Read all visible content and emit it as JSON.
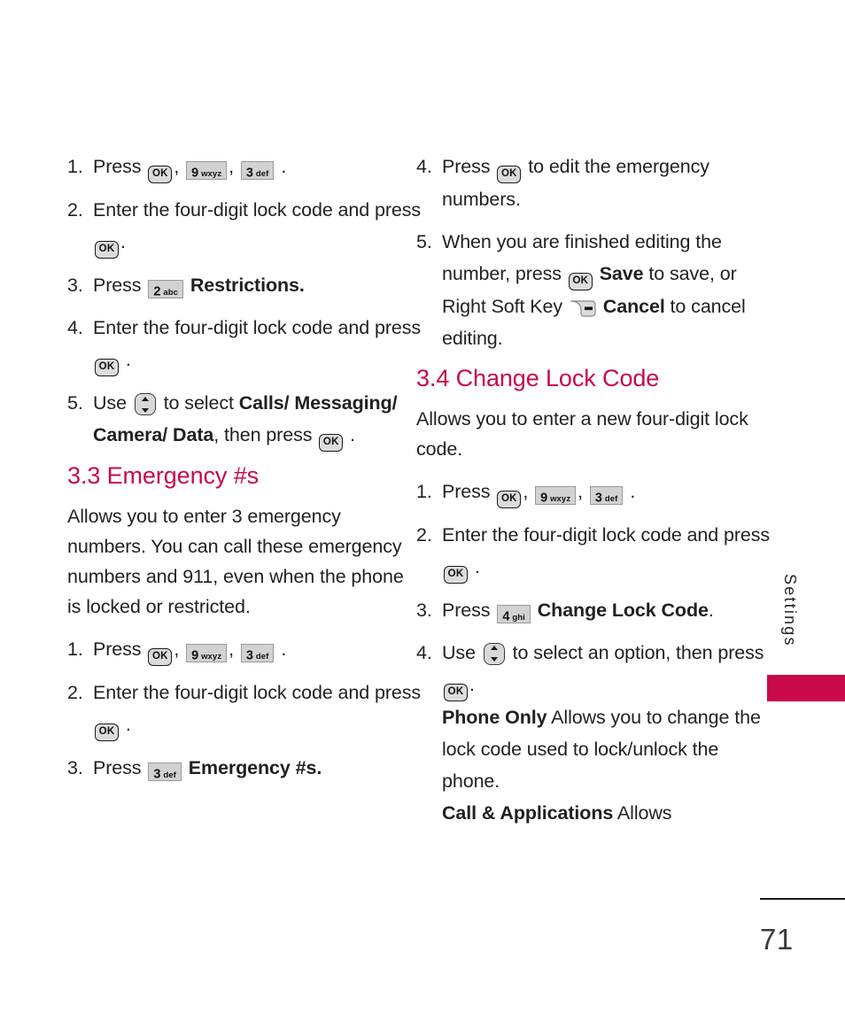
{
  "document": {
    "page_number": "71",
    "side_tab_label": "Settings",
    "accent_color": "#C8094A",
    "text_color": "#231f20"
  },
  "keys": {
    "ok": "OK",
    "nav": "navigation-up-down",
    "right_soft": "right-soft-key",
    "k2": {
      "digit": "2",
      "letters": "abc"
    },
    "k3": {
      "digit": "3",
      "letters": "def"
    },
    "k4": {
      "digit": "4",
      "letters": "ghi"
    },
    "k9": {
      "digit": "9",
      "letters": "wxyz"
    }
  },
  "left_column": {
    "steps_top": [
      {
        "num": "1.",
        "parts": [
          {
            "t": "text",
            "v": "Press "
          },
          {
            "t": "key-ok"
          },
          {
            "t": "text",
            "v": ", "
          },
          {
            "t": "key-num",
            "k": "k9"
          },
          {
            "t": "text",
            "v": ", "
          },
          {
            "t": "key-num",
            "k": "k3"
          },
          {
            "t": "text",
            "v": " ."
          }
        ]
      },
      {
        "num": "2.",
        "parts": [
          {
            "t": "text",
            "v": "Enter the four-digit lock code and press "
          },
          {
            "t": "key-ok"
          },
          {
            "t": "text",
            "v": "."
          }
        ]
      },
      {
        "num": "3.",
        "parts": [
          {
            "t": "text",
            "v": "Press "
          },
          {
            "t": "key-num",
            "k": "k2"
          },
          {
            "t": "text",
            "v": "  "
          },
          {
            "t": "bold",
            "v": "Restrictions."
          }
        ]
      },
      {
        "num": "4.",
        "parts": [
          {
            "t": "text",
            "v": "Enter the four-digit lock code and press "
          },
          {
            "t": "key-ok"
          },
          {
            "t": "text",
            "v": " ."
          }
        ]
      },
      {
        "num": "5.",
        "parts": [
          {
            "t": "text",
            "v": "Use "
          },
          {
            "t": "key-nav"
          },
          {
            "t": "text",
            "v": " to select "
          },
          {
            "t": "bold",
            "v": "Calls/ Messaging/ Camera/ Data"
          },
          {
            "t": "text",
            "v": ", then press "
          },
          {
            "t": "key-ok"
          },
          {
            "t": "text",
            "v": " ."
          }
        ]
      }
    ],
    "section": {
      "heading": "3.3 Emergency #s",
      "intro": "Allows you to enter 3 emergency numbers. You can call these emergency numbers and 911, even when the phone is locked or restricted.",
      "steps": [
        {
          "num": "1.",
          "parts": [
            {
              "t": "text",
              "v": "Press "
            },
            {
              "t": "key-ok"
            },
            {
              "t": "text",
              "v": ", "
            },
            {
              "t": "key-num",
              "k": "k9"
            },
            {
              "t": "text",
              "v": ", "
            },
            {
              "t": "key-num",
              "k": "k3"
            },
            {
              "t": "text",
              "v": " ."
            }
          ]
        },
        {
          "num": "2.",
          "parts": [
            {
              "t": "text",
              "v": "Enter the four-digit lock code and press "
            },
            {
              "t": "key-ok"
            },
            {
              "t": "text",
              "v": " ."
            }
          ]
        },
        {
          "num": "3.",
          "parts": [
            {
              "t": "text",
              "v": "Press "
            },
            {
              "t": "key-num",
              "k": "k3"
            },
            {
              "t": "text",
              "v": "  "
            },
            {
              "t": "bold",
              "v": "Emergency #s."
            }
          ]
        }
      ]
    }
  },
  "right_column": {
    "steps_top": [
      {
        "num": "4.",
        "parts": [
          {
            "t": "text",
            "v": "Press "
          },
          {
            "t": "key-ok"
          },
          {
            "t": "text",
            "v": " to edit the emergency numbers."
          }
        ]
      },
      {
        "num": "5.",
        "parts": [
          {
            "t": "text",
            "v": "When you are finished editing the number, press "
          },
          {
            "t": "key-ok"
          },
          {
            "t": "text",
            "v": " "
          },
          {
            "t": "bold",
            "v": "Save"
          },
          {
            "t": "text",
            "v": " to save, or Right Soft Key "
          },
          {
            "t": "key-soft"
          },
          {
            "t": "text",
            "v": " "
          },
          {
            "t": "bold",
            "v": "Cancel"
          },
          {
            "t": "text",
            "v": " to cancel editing."
          }
        ]
      }
    ],
    "section": {
      "heading": "3.4 Change Lock Code",
      "intro": "Allows you to enter a new four-digit lock code.",
      "steps": [
        {
          "num": "1.",
          "parts": [
            {
              "t": "text",
              "v": "Press "
            },
            {
              "t": "key-ok"
            },
            {
              "t": "text",
              "v": ", "
            },
            {
              "t": "key-num",
              "k": "k9"
            },
            {
              "t": "text",
              "v": ", "
            },
            {
              "t": "key-num",
              "k": "k3"
            },
            {
              "t": "text",
              "v": " ."
            }
          ]
        },
        {
          "num": "2.",
          "parts": [
            {
              "t": "text",
              "v": "Enter the four-digit lock code and press "
            },
            {
              "t": "key-ok"
            },
            {
              "t": "text",
              "v": " ."
            }
          ]
        },
        {
          "num": "3.",
          "parts": [
            {
              "t": "text",
              "v": "Press "
            },
            {
              "t": "key-num",
              "k": "k4"
            },
            {
              "t": "text",
              "v": "  "
            },
            {
              "t": "bold",
              "v": "Change Lock Code"
            },
            {
              "t": "text",
              "v": "."
            }
          ]
        },
        {
          "num": "4.",
          "parts": [
            {
              "t": "text",
              "v": "Use "
            },
            {
              "t": "key-nav"
            },
            {
              "t": "text",
              "v": " to select an option, then press "
            },
            {
              "t": "key-ok"
            },
            {
              "t": "text",
              "v": "."
            },
            {
              "t": "break"
            },
            {
              "t": "bold",
              "v": "Phone Only"
            },
            {
              "t": "text",
              "v": " Allows you to change the lock code used to lock/unlock the phone."
            },
            {
              "t": "break"
            },
            {
              "t": "bold",
              "v": "Call & Applications"
            },
            {
              "t": "text",
              "v": " Allows"
            }
          ]
        }
      ]
    }
  }
}
